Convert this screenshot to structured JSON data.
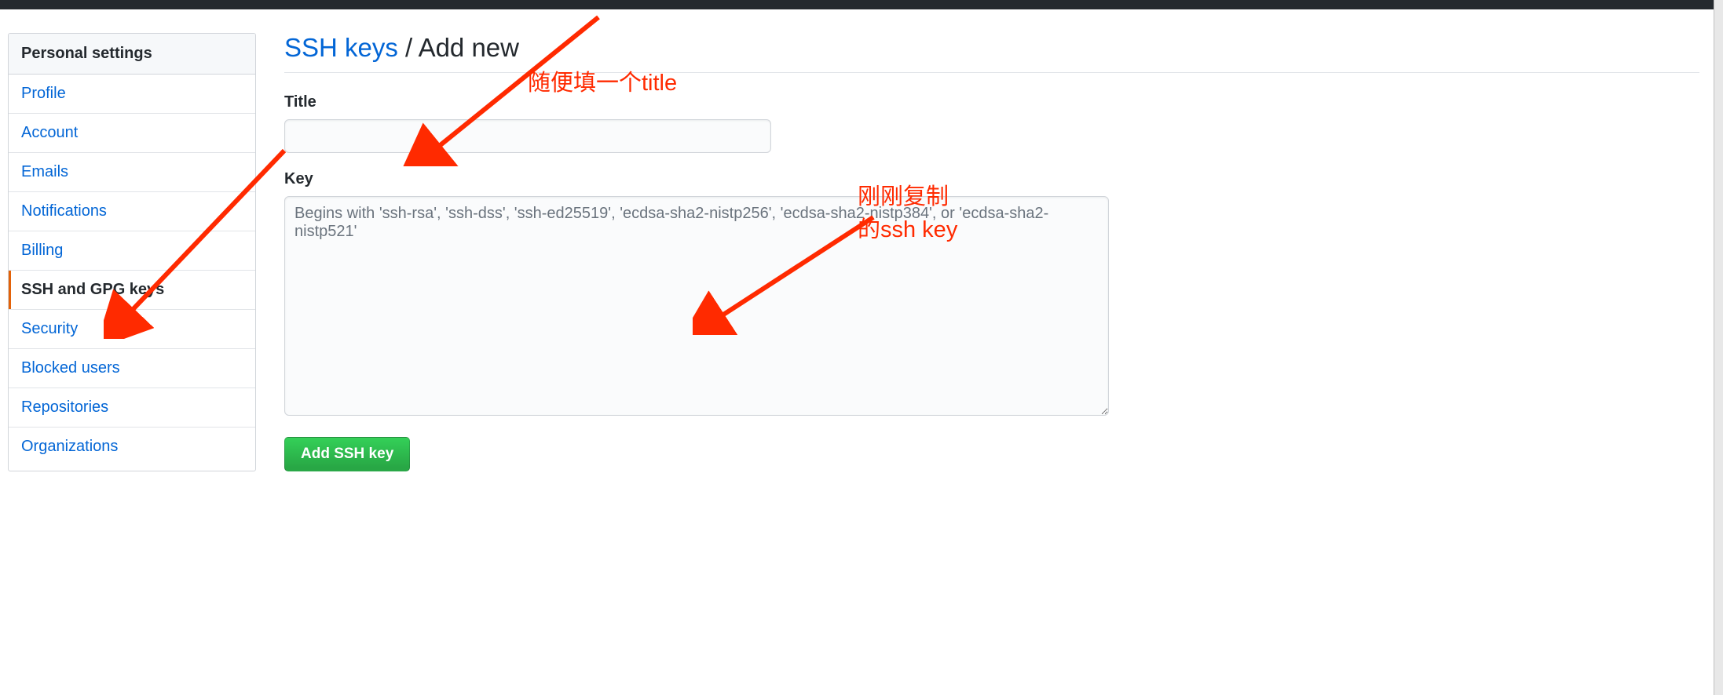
{
  "sidebar": {
    "header": "Personal settings",
    "items": [
      {
        "label": "Profile",
        "active": false
      },
      {
        "label": "Account",
        "active": false
      },
      {
        "label": "Emails",
        "active": false
      },
      {
        "label": "Notifications",
        "active": false
      },
      {
        "label": "Billing",
        "active": false
      },
      {
        "label": "SSH and GPG keys",
        "active": true
      },
      {
        "label": "Security",
        "active": false
      },
      {
        "label": "Blocked users",
        "active": false
      },
      {
        "label": "Repositories",
        "active": false
      },
      {
        "label": "Organizations",
        "active": false
      }
    ]
  },
  "page": {
    "breadcrumb_link": "SSH keys",
    "breadcrumb_sep": " / ",
    "breadcrumb_current": "Add new"
  },
  "form": {
    "title_label": "Title",
    "title_value": "",
    "key_label": "Key",
    "key_value": "",
    "key_placeholder": "Begins with 'ssh-rsa', 'ssh-dss', 'ssh-ed25519', 'ecdsa-sha2-nistp256', 'ecdsa-sha2-nistp384', or 'ecdsa-sha2-nistp521'",
    "submit_label": "Add SSH key"
  },
  "annotations": {
    "title_note": "随便填一个title",
    "key_note_line1": "刚刚复制",
    "key_note_line2": "的ssh key"
  }
}
